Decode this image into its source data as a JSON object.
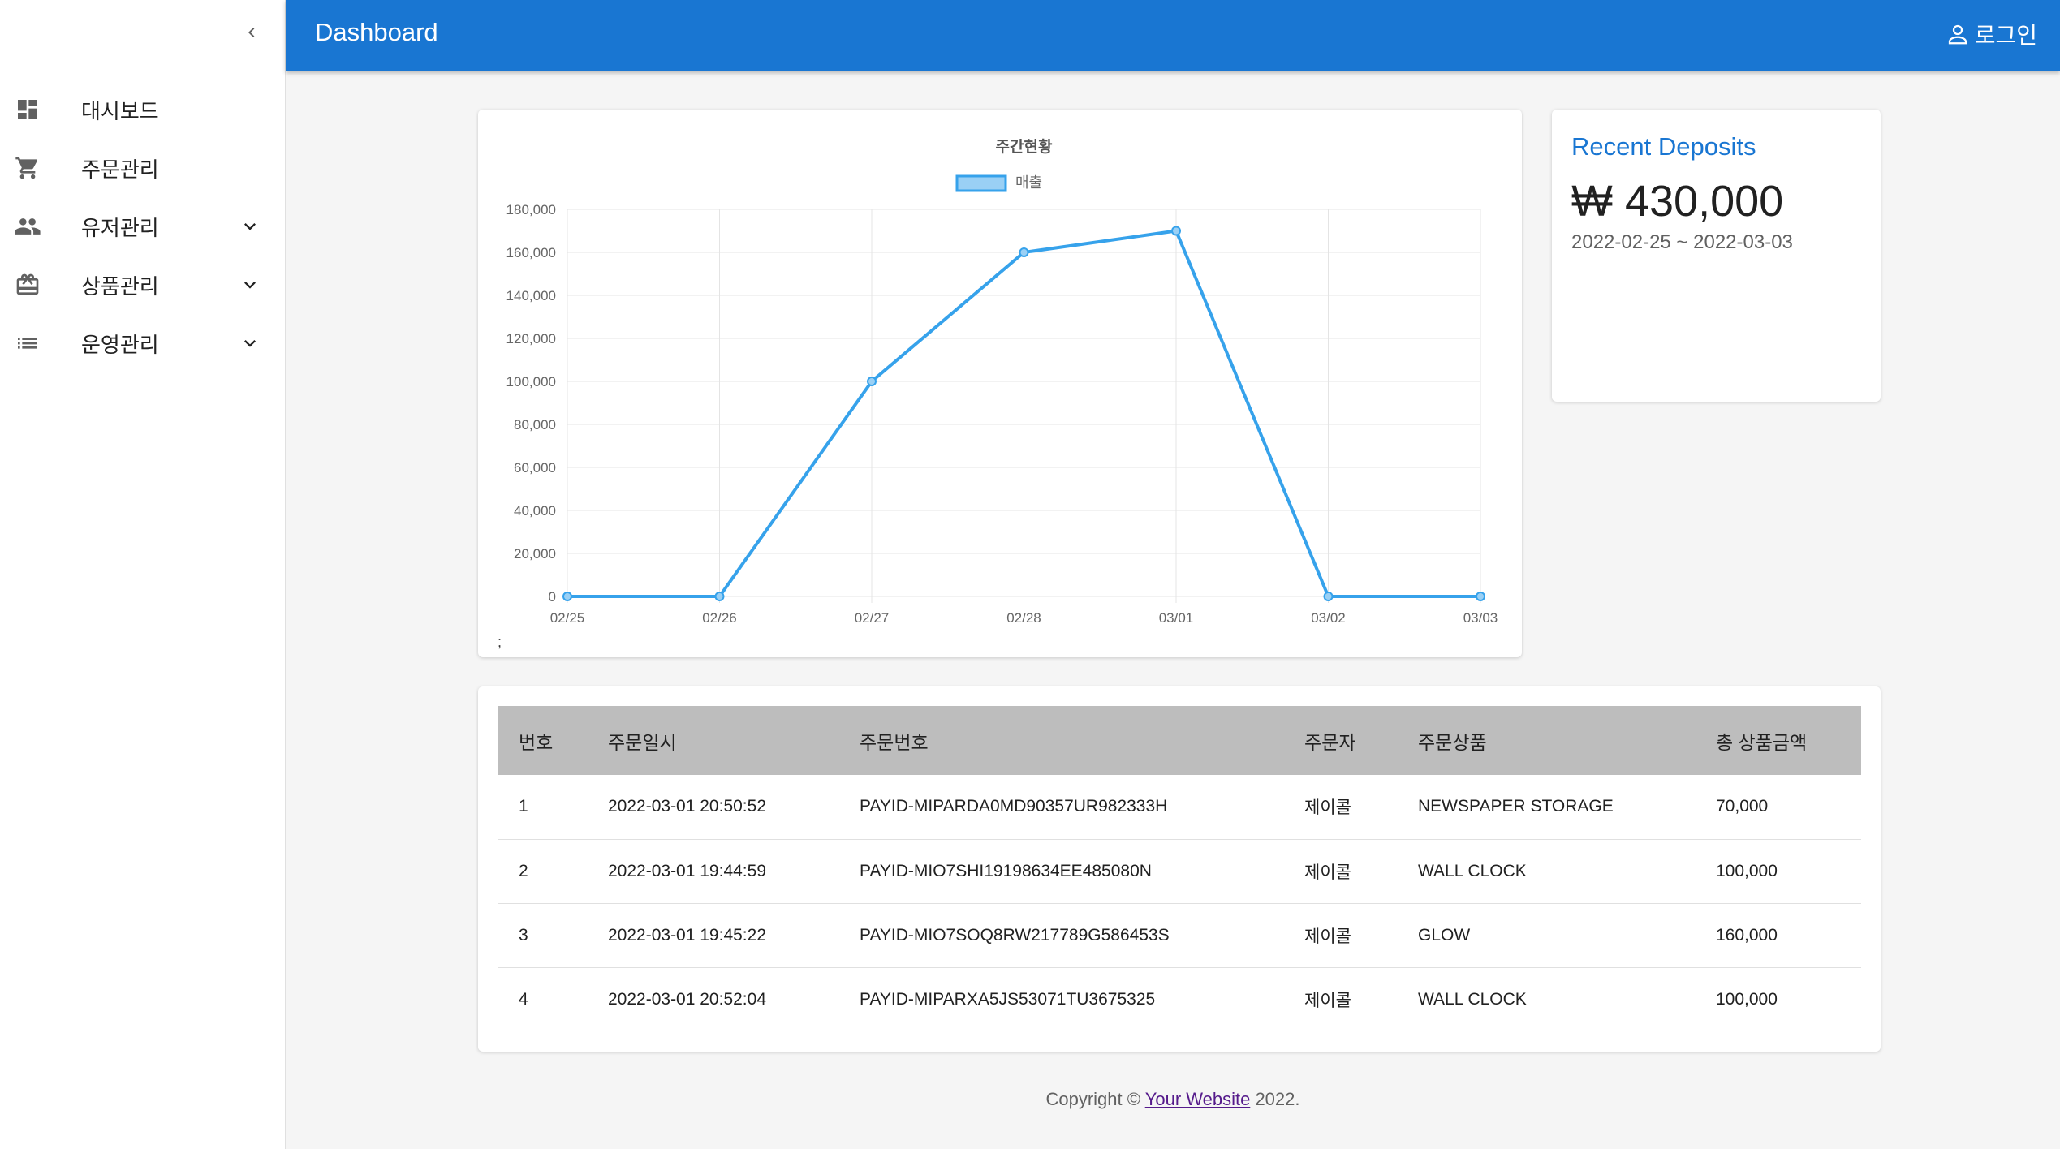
{
  "app": {
    "title": "Dashboard",
    "login_label": "로그인"
  },
  "sidebar": {
    "items": [
      {
        "label": "대시보드",
        "icon": "dashboard-icon",
        "expandable": false
      },
      {
        "label": "주문관리",
        "icon": "cart-icon",
        "expandable": false
      },
      {
        "label": "유저관리",
        "icon": "people-icon",
        "expandable": true
      },
      {
        "label": "상품관리",
        "icon": "redeem-icon",
        "expandable": true
      },
      {
        "label": "운영관리",
        "icon": "list-icon",
        "expandable": true
      }
    ]
  },
  "colors": {
    "primary": "#1976d2",
    "line": "#36a2eb",
    "line_fill": "#9ad0f5",
    "header_row": "#bdbdbd"
  },
  "chart_data": {
    "type": "line",
    "title": "주간현황",
    "categories": [
      "02/25",
      "02/26",
      "02/27",
      "02/28",
      "03/01",
      "03/02",
      "03/03"
    ],
    "series": [
      {
        "name": "매출",
        "values": [
          0,
          0,
          100000,
          160000,
          170000,
          0,
          0
        ]
      }
    ],
    "yticks": [
      "0",
      "20,000",
      "40,000",
      "60,000",
      "80,000",
      "100,000",
      "120,000",
      "140,000",
      "160,000",
      "180,000"
    ],
    "ylim": [
      0,
      180000
    ],
    "grid": true,
    "legend": "top-center"
  },
  "chart_footer": ";",
  "deposits": {
    "title": "Recent Deposits",
    "amount": "₩ 430,000",
    "range": "2022-02-25 ~ 2022-03-03"
  },
  "orders": {
    "columns": [
      "번호",
      "주문일시",
      "주문번호",
      "주문자",
      "주문상품",
      "총 상품금액"
    ],
    "rows": [
      [
        "1",
        "2022-03-01 20:50:52",
        "PAYID-MIPARDA0MD90357UR982333H",
        "제이콜",
        "NEWSPAPER STORAGE",
        "70,000"
      ],
      [
        "2",
        "2022-03-01 19:44:59",
        "PAYID-MIO7SHI19198634EE485080N",
        "제이콜",
        "WALL CLOCK",
        "100,000"
      ],
      [
        "3",
        "2022-03-01 19:45:22",
        "PAYID-MIO7SOQ8RW217789G586453S",
        "제이콜",
        "GLOW",
        "160,000"
      ],
      [
        "4",
        "2022-03-01 20:52:04",
        "PAYID-MIPARXA5JS53071TU3675325",
        "제이콜",
        "WALL CLOCK",
        "100,000"
      ]
    ]
  },
  "footer": {
    "prefix": "Copyright © ",
    "link": "Your Website",
    "suffix": " 2022."
  }
}
